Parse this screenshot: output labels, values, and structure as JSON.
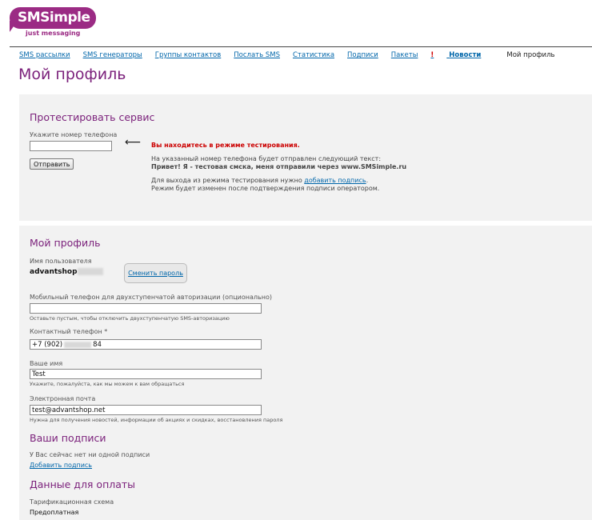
{
  "logo": {
    "name": "SMSimple",
    "tagline": "just messaging"
  },
  "nav": {
    "items": [
      "SMS рассылки",
      "SMS генераторы",
      "Группы контактов",
      "Послать SMS",
      "Статистика",
      "Подписи",
      "Пакеты"
    ],
    "news_prefix": "!",
    "news_label": "Новости",
    "active": "Мой профиль"
  },
  "page_title": "Мой профиль",
  "test": {
    "heading": "Протестировать сервис",
    "phone_label": "Укажите номер телефона",
    "phone_value": "",
    "send_button": "Отправить",
    "warning": "Вы находитесь в режиме тестирования.",
    "line1": "На указанный номер телефона будет отправлен следующий текст:",
    "line2": "Привет! Я - тестовая смска, меня отправили через www.SMSimple.ru",
    "line3_prefix": "Для выхода из режима тестирования нужно ",
    "line3_link": "добавить подпись",
    "line3_suffix": ".",
    "line4": "Режим будет изменен после подтверждения подписи оператором."
  },
  "profile": {
    "heading": "Мой профиль",
    "username_label": "Имя пользователя",
    "username_value": "advantshop",
    "change_password": "Сменить пароль",
    "mobile_label": "Мобильный телефон для двухступенчатой авторизации (опционально)",
    "mobile_value": "",
    "mobile_hint": "Оставьте пустым, чтобы отключить двухступенчатую SMS-авторизацию",
    "contact_label": "Контактный телефон *",
    "contact_prefix": "+7 (902)",
    "contact_suffix": "84",
    "name_label": "Ваше имя",
    "name_value": "Test",
    "name_hint": "Укажите, пожалуйста, как мы можем к вам обращаться",
    "email_label": "Электронная почта",
    "email_value": "test@advantshop.net",
    "email_hint": "Нужна для получения новостей, информации об акциях и скидках, восстановления пароля"
  },
  "signatures": {
    "heading": "Ваши подписи",
    "empty_text": "У Вас сейчас нет ни одной подписи",
    "add_link": "Добавить подпись"
  },
  "payment": {
    "heading": "Данные для оплаты",
    "scheme_label": "Тарификационная схема",
    "scheme_value": "Предоплатная"
  },
  "colors": {
    "brand": "#9b2b84",
    "heading": "#7a1f7a",
    "link": "#0066aa",
    "warning": "#cc0000"
  }
}
